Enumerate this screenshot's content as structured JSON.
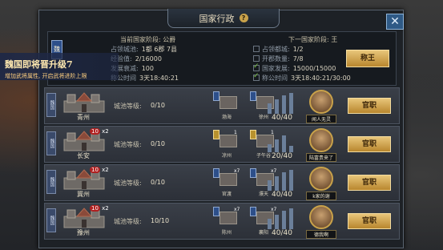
{
  "panel": {
    "title": "国家行政",
    "close_label": "✕"
  },
  "current": {
    "section_title": "当前国家阶段: 公爵",
    "faction": "魏",
    "rows": [
      {
        "key": "占领城池:",
        "value": "1都 6郡 7县"
      },
      {
        "key": "经验值:",
        "value": "2/16000"
      },
      {
        "key": "发展衰减:",
        "value": "100"
      },
      {
        "key": "称公时间",
        "value": "3天18:40:21"
      }
    ]
  },
  "next": {
    "section_title": "下一国家阶段: 王",
    "rows": [
      {
        "key": "占领都城:",
        "value": "1/2",
        "checked": false
      },
      {
        "key": "开郡数量:",
        "value": "7/8",
        "checked": false
      },
      {
        "key": "国家发展:",
        "value": "15000/15000",
        "checked": true
      },
      {
        "key": "称公时间",
        "value": "3天18:40:21/30:00",
        "checked": true
      }
    ],
    "button_label": "称王"
  },
  "banner": {
    "title": "魏国即将晋升级7",
    "subtitle": "增加武将属性, 开启武将进阶上限"
  },
  "cities": [
    {
      "flag": "魏国",
      "name": "青州",
      "level_label": "城池等级:",
      "level": "0/10",
      "subs": [
        {
          "name": "渤海",
          "count": ""
        },
        {
          "name": "徐州",
          "count": ""
        }
      ],
      "bars": "40/40",
      "bar_fill": [
        0.5,
        0.7,
        0.9,
        1.0
      ],
      "officer": "闻人无灵",
      "button": "官职"
    },
    {
      "flag": "魏国",
      "name": "长安",
      "level": "0/10",
      "level_label": "城池等级:",
      "lv": "10",
      "subs": [
        {
          "name": "凉州",
          "count": "1",
          "gold": true
        },
        {
          "name": "子午谷",
          "count": "1",
          "gold": true
        }
      ],
      "bars": "20/40",
      "bar_fill": [
        0.4,
        0.6,
        0.8,
        0.3
      ],
      "officer": "陆富贵来了",
      "button": "官职"
    },
    {
      "flag": "魏国",
      "name": "冀州",
      "level": "0/10",
      "level_label": "城池等级:",
      "lv": "10",
      "subs": [
        {
          "name": "官渡",
          "count": "x7"
        },
        {
          "name": "濮天",
          "count": "x7"
        }
      ],
      "bars": "40/40",
      "bar_fill": [
        0.5,
        0.7,
        0.9,
        1.0
      ],
      "officer": "k家的谢",
      "button": "官职"
    },
    {
      "flag": "魏国",
      "name": "豫州",
      "level": "10/10",
      "level_label": "城池等级:",
      "lv": "10",
      "subs": [
        {
          "name": "陈州",
          "count": "x7"
        },
        {
          "name": "襄阳",
          "count": "x7"
        }
      ],
      "bars": "40/40",
      "bar_fill": [
        0.5,
        0.7,
        0.9,
        1.0
      ],
      "officer": "德我啊",
      "button": "官职"
    }
  ]
}
